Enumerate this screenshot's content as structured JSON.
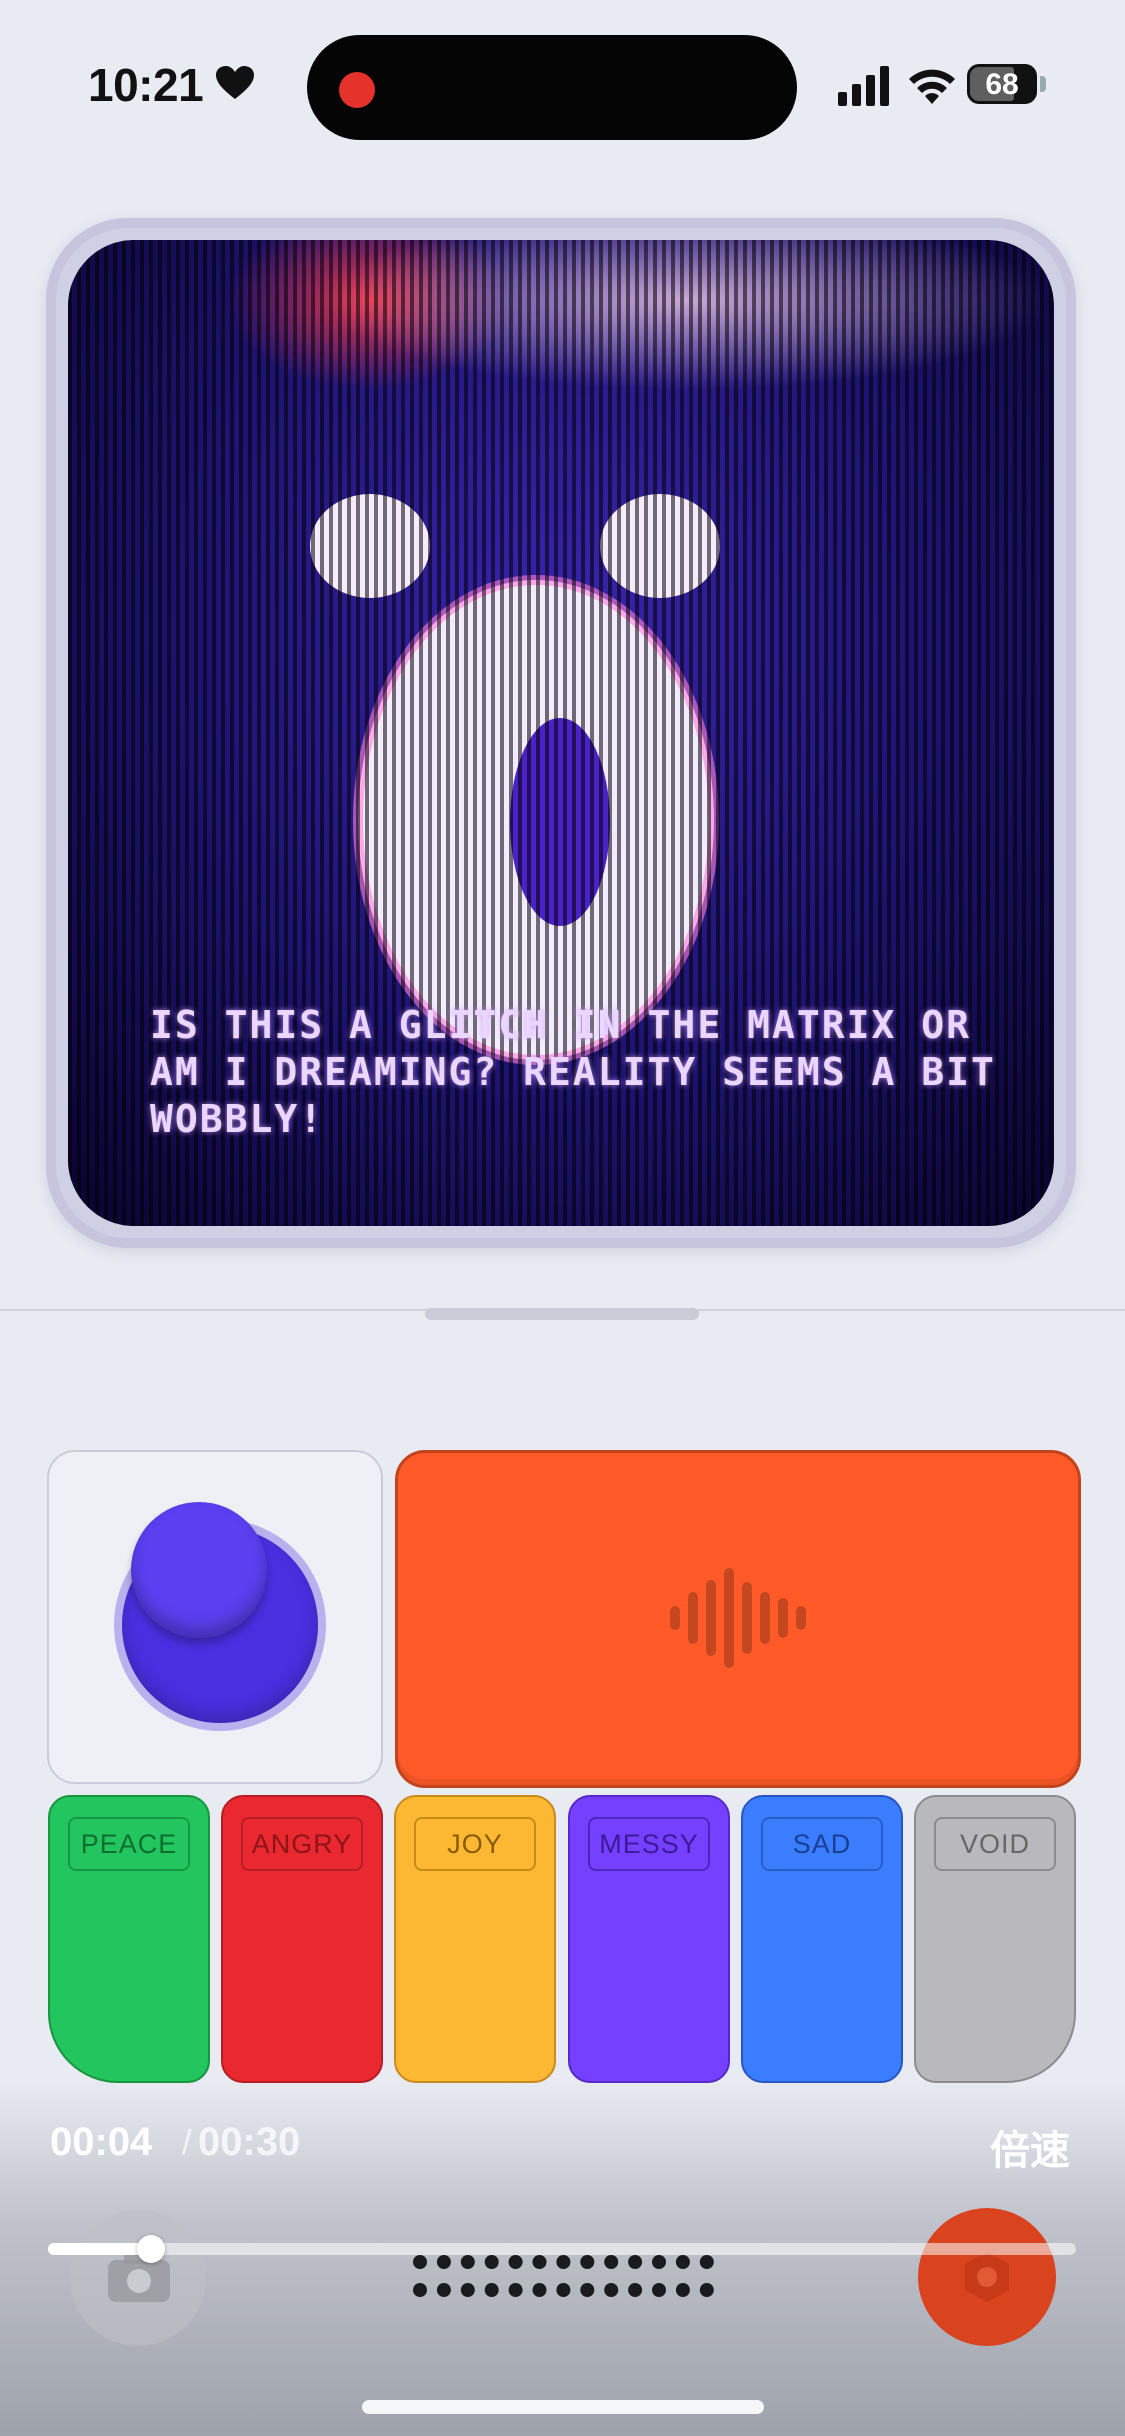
{
  "status_bar": {
    "time": "10:21",
    "battery": "68",
    "icons": [
      "heart-icon",
      "signal-icon",
      "wifi-icon",
      "battery-icon"
    ]
  },
  "screen": {
    "caption": "IS THIS A GLITCH IN THE MATRIX OR AM I DREAMING? REALITY SEEMS A BIT WOBBLY!"
  },
  "controls": {
    "voice_icon": "waveform-icon",
    "moods": [
      {
        "label": "PEACE",
        "color": "#22c55e"
      },
      {
        "label": "ANGRY",
        "color": "#e9282f"
      },
      {
        "label": "JOY",
        "color": "#fdb833"
      },
      {
        "label": "MESSY",
        "color": "#7540ff"
      },
      {
        "label": "SAD",
        "color": "#3b7dff"
      },
      {
        "label": "VOID",
        "color": "#b9b9bd"
      }
    ]
  },
  "playback": {
    "current": "00:04",
    "separator": "/",
    "total": "00:30",
    "speed_label": "倍速",
    "progress": 0.1
  },
  "colors": {
    "accent_orange": "#ff5a28",
    "joystick": "#5b3ff0"
  }
}
